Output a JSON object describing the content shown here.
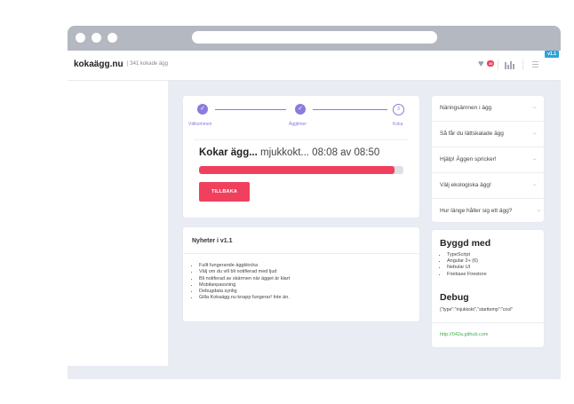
{
  "app": {
    "name": "kokaägg.nu",
    "subtitle": "341 kokade ägg",
    "version": "v1.1",
    "favorites_count": "10"
  },
  "stepper": {
    "steps": [
      {
        "label": "Välkommen",
        "icon": "check-icon",
        "state": "done"
      },
      {
        "label": "Äggtimer",
        "icon": "check-icon",
        "state": "done"
      },
      {
        "label": "Koka",
        "icon": "3",
        "state": "active"
      }
    ]
  },
  "timer": {
    "title": "Kokar ägg...",
    "detail": "mjukkokt... 08:08 av 08:50",
    "progress": 0.955,
    "back_button": "TILLBAKA"
  },
  "news": {
    "title": "Nyheter i v1.1",
    "items": [
      "Fullt fungerande äggklocka",
      "Välj om du vill bli notifierad med ljud",
      "Bli notiferad av skärmen när ägget är klart",
      "Mobilanpassning",
      "Debugdata synlig",
      "Gilla Kokaägg.nu knapp fungerar! Inte än."
    ]
  },
  "faq": {
    "items": [
      "Näringsämnen i ägg",
      "Så får du lättskalade ägg",
      "Hjälp! Äggen spricker!",
      "Välj ekologiska ägg!",
      "Hur länge håller sig ett ägg?"
    ]
  },
  "built_with": {
    "title": "Byggd med",
    "items": [
      "TypeScript",
      "Angular 2+ (6)",
      "Nebular UI",
      "Firebase Firestore"
    ]
  },
  "debug": {
    "title": "Debug",
    "text": "{\"type\":\"mjukkokt\",\"starttemp\":\"cool\""
  },
  "footer_link": "http://042a.github.com",
  "colors": {
    "accent": "#f0405e",
    "stepper": "#8b7bdc",
    "version_badge": "#2aa4d9",
    "link": "#3fae4c"
  }
}
